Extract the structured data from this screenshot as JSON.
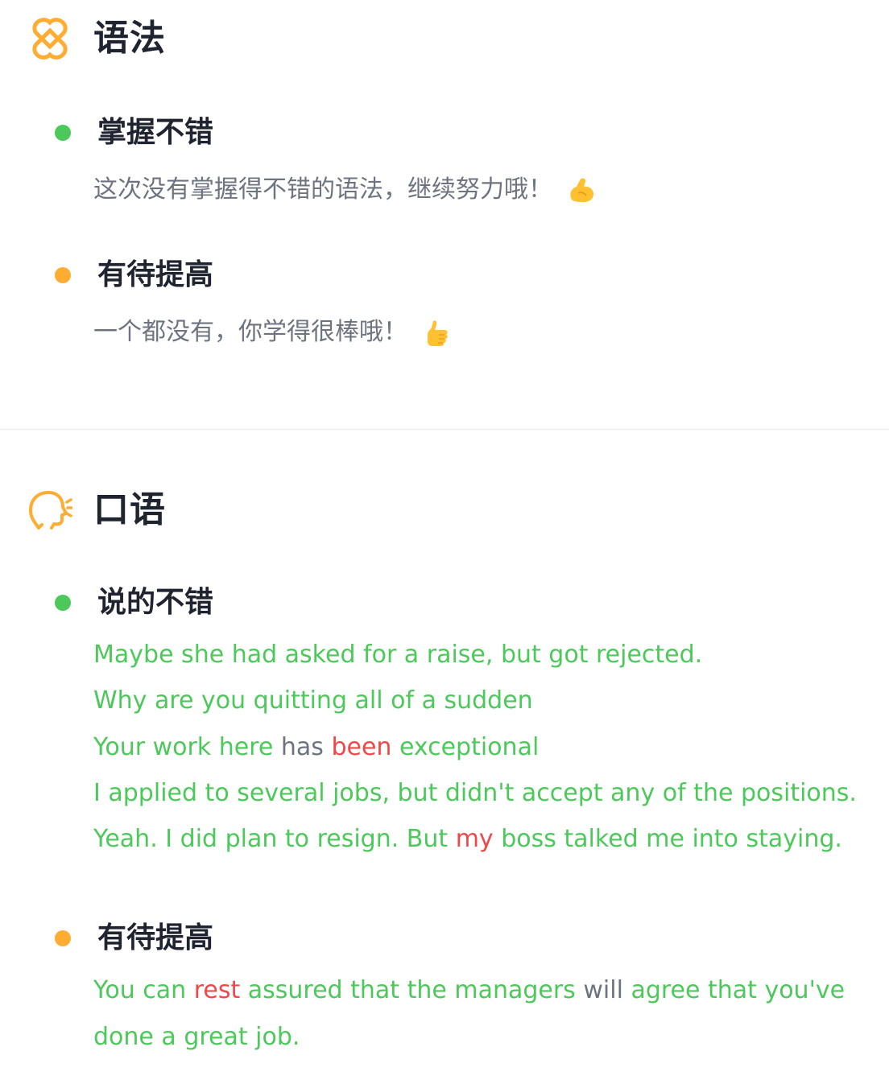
{
  "grammar": {
    "title": "语法",
    "icon": "grammar-knot-icon",
    "good": {
      "title": "掌握不错",
      "text": "这次没有掌握得不错的语法，继续努力哦！",
      "emoji": "flexed-biceps-icon"
    },
    "improve": {
      "title": "有待提高",
      "text": "一个都没有，你学得很棒哦！",
      "emoji": "thumbs-up-icon"
    }
  },
  "speaking": {
    "title": "口语",
    "icon": "speaking-head-icon",
    "good": {
      "title": "说的不错",
      "sentences": [
        [
          {
            "t": "Maybe she had asked for a raise, but got rejected.",
            "c": "g"
          }
        ],
        [
          {
            "t": "Why are you quitting all of a sudden",
            "c": "g"
          }
        ],
        [
          {
            "t": "Your work here ",
            "c": "g"
          },
          {
            "t": "has ",
            "c": "y"
          },
          {
            "t": "been ",
            "c": "r"
          },
          {
            "t": "exceptional",
            "c": "g"
          }
        ],
        [
          {
            "t": "I applied to several jobs, but didn't accept any of the positions.",
            "c": "g"
          }
        ],
        [
          {
            "t": "Yeah. I did plan to resign. But ",
            "c": "g"
          },
          {
            "t": "my ",
            "c": "r"
          },
          {
            "t": "boss talked me into staying.",
            "c": "g"
          }
        ]
      ]
    },
    "improve": {
      "title": "有待提高",
      "sentences": [
        [
          {
            "t": "You can ",
            "c": "g"
          },
          {
            "t": "rest ",
            "c": "r"
          },
          {
            "t": "assured that the managers ",
            "c": "g"
          },
          {
            "t": "will ",
            "c": "y"
          },
          {
            "t": "agree that you've done a great job.",
            "c": "g"
          }
        ]
      ]
    }
  },
  "colors": {
    "accent_orange": "#ffac33",
    "good_green": "#4cc95a",
    "error_red": "#f04848",
    "neutral_gray": "#6e7380"
  }
}
